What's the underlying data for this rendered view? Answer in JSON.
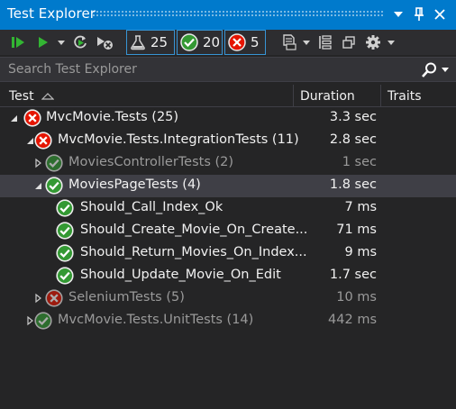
{
  "window": {
    "title": "Test Explorer"
  },
  "toolbar": {
    "counters": {
      "total": "25",
      "passed": "20",
      "failed": "5"
    },
    "icons": [
      "run-all-icon",
      "run-icon",
      "dropdown-caret-icon",
      "refresh-icon",
      "cancel-icon",
      "flask-icon",
      "check-icon",
      "error-icon",
      "playlist-icon",
      "dropdown-caret-icon",
      "group-by-icon",
      "window-icon",
      "gear-icon",
      "dropdown-caret-icon"
    ]
  },
  "search": {
    "placeholder": "Search Test Explorer"
  },
  "columns": {
    "test": "Test",
    "duration": "Duration",
    "traits": "Traits"
  },
  "colors": {
    "title_bar": "#007acc",
    "failed": "#e51400",
    "passed": "#339933",
    "selection": "#3f3f46",
    "background": "#252526"
  },
  "tree": [
    {
      "label": "MvcMovie.Tests (25)",
      "duration": "3.3 sec",
      "status": "failed",
      "depth": 0,
      "expanded": true,
      "dim": false,
      "selected": false
    },
    {
      "label": "MvcMovie.Tests.IntegrationTests (11)",
      "duration": "2.8 sec",
      "status": "failed",
      "depth": 1,
      "expanded": true,
      "dim": false,
      "selected": false
    },
    {
      "label": "MoviesControllerTests (2)",
      "duration": "1 sec",
      "status": "passed",
      "depth": 2,
      "expanded": false,
      "dim": true,
      "selected": false
    },
    {
      "label": "MoviesPageTests (4)",
      "duration": "1.8 sec",
      "status": "passed",
      "depth": 2,
      "expanded": true,
      "dim": false,
      "selected": true
    },
    {
      "label": "Should_Call_Index_Ok",
      "duration": "7 ms",
      "status": "passed",
      "depth": 3,
      "expanded": null,
      "dim": false,
      "selected": false
    },
    {
      "label": "Should_Create_Movie_On_Create...",
      "duration": "71 ms",
      "status": "passed",
      "depth": 3,
      "expanded": null,
      "dim": false,
      "selected": false
    },
    {
      "label": "Should_Return_Movies_On_Index...",
      "duration": "9 ms",
      "status": "passed",
      "depth": 3,
      "expanded": null,
      "dim": false,
      "selected": false
    },
    {
      "label": "Should_Update_Movie_On_Edit",
      "duration": "1.7 sec",
      "status": "passed",
      "depth": 3,
      "expanded": null,
      "dim": false,
      "selected": false
    },
    {
      "label": "SeleniumTests (5)",
      "duration": "10 ms",
      "status": "failed",
      "depth": 2,
      "expanded": false,
      "dim": true,
      "selected": false
    },
    {
      "label": "MvcMovie.Tests.UnitTests (14)",
      "duration": "442 ms",
      "status": "passed",
      "depth": 1,
      "expanded": false,
      "dim": true,
      "selected": false
    }
  ]
}
